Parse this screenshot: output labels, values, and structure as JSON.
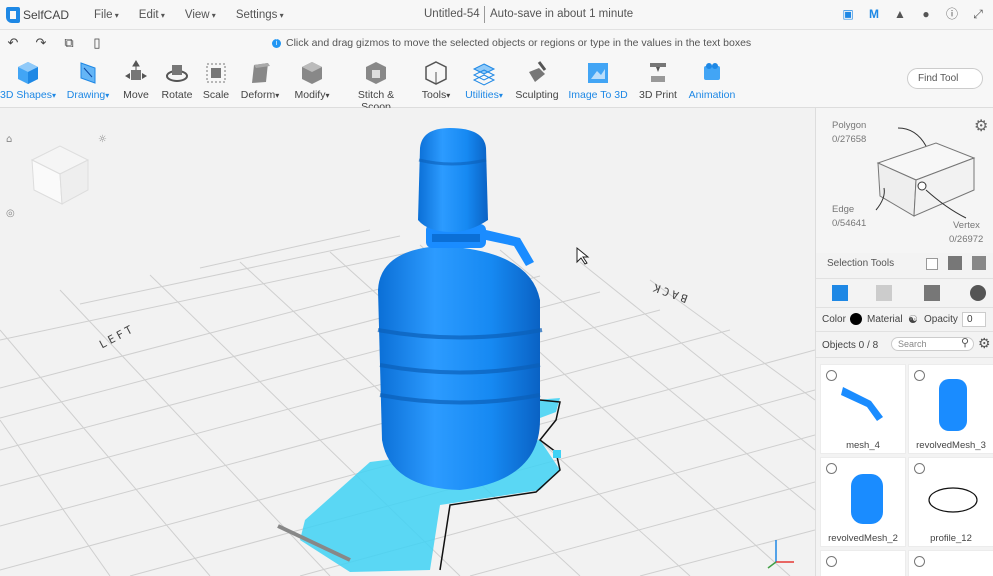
{
  "app": {
    "name": "SelfCAD"
  },
  "menu": {
    "file": "File",
    "edit": "Edit",
    "view": "View",
    "settings": "Settings"
  },
  "document": {
    "title": "Untitled-54",
    "autosave": "Auto-save in about 1 minute"
  },
  "hint": {
    "text": "Click and drag gizmos to move the selected objects or regions or type in the values in the text boxes"
  },
  "toolbar": {
    "shapes": "3D Shapes",
    "drawing": "Drawing",
    "move": "Move",
    "rotate": "Rotate",
    "scale": "Scale",
    "deform": "Deform",
    "modify": "Modify",
    "stitch": "Stitch & Scoop",
    "tools": "Tools",
    "utilities": "Utilities",
    "sculpting": "Sculpting",
    "image_to_3d": "Image To 3D",
    "print_3d": "3D Print",
    "animation": "Animation",
    "find_tool": "Find Tool"
  },
  "viewport": {
    "label_left": "LEFT",
    "label_back": "BACK"
  },
  "selection": {
    "polygon_label": "Polygon",
    "polygon_count": "0/27658",
    "edge_label": "Edge",
    "edge_count": "0/54641",
    "vertex_label": "Vertex",
    "vertex_count": "0/26972",
    "tools_title": "Selection Tools"
  },
  "properties": {
    "color_label": "Color",
    "material_label": "Material",
    "opacity_label": "Opacity",
    "opacity_value": "0"
  },
  "objects": {
    "header": "Objects 0 / 8",
    "search_placeholder": "Search",
    "items": [
      {
        "name": "mesh_4"
      },
      {
        "name": "revolvedMesh_3"
      },
      {
        "name": "revolvedMesh_2"
      },
      {
        "name": "profile_12"
      }
    ]
  },
  "colors": {
    "accent": "#1e88e5",
    "model": "#1a8cff",
    "selection_shadow": "#3fd2f5"
  }
}
